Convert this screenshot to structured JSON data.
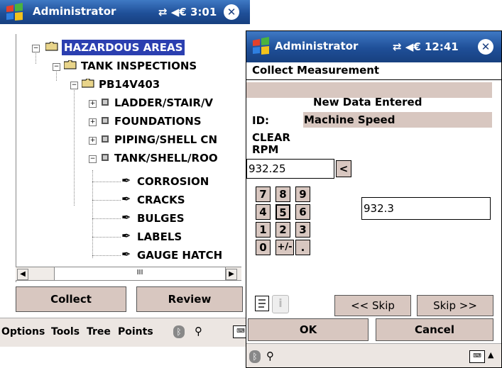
{
  "left_window": {
    "title": "Administrator",
    "status": "⇄ ◀€ 3:01",
    "tree": [
      {
        "label": "HAZARDOUS AREAS",
        "level": 1,
        "type": "folder",
        "expanded": true,
        "selected": true
      },
      {
        "label": "TANK INSPECTIONS",
        "level": 2,
        "type": "folder",
        "expanded": true
      },
      {
        "label": "PB14V403",
        "level": 3,
        "type": "folder",
        "expanded": true
      },
      {
        "label": "LADDER/STAIR/V",
        "level": 4,
        "type": "node",
        "expanded": false
      },
      {
        "label": "FOUNDATIONS",
        "level": 4,
        "type": "node",
        "expanded": false
      },
      {
        "label": "PIPING/SHELL CN",
        "level": 4,
        "type": "node",
        "expanded": false
      },
      {
        "label": "TANK/SHELL/ROO",
        "level": 4,
        "type": "node",
        "expanded": true
      },
      {
        "label": "CORROSION",
        "level": 5,
        "type": "point"
      },
      {
        "label": "CRACKS",
        "level": 5,
        "type": "point"
      },
      {
        "label": "BULGES",
        "level": 5,
        "type": "point"
      },
      {
        "label": "LABELS",
        "level": 5,
        "type": "point"
      },
      {
        "label": "GAUGE HATCH",
        "level": 5,
        "type": "point"
      }
    ],
    "scroll_thumb": "III",
    "buttons": {
      "collect": "Collect",
      "review": "Review"
    },
    "menu": {
      "options": "Options",
      "tools": "Tools",
      "tree": "Tree",
      "points": "Points"
    }
  },
  "right_window": {
    "title": "Administrator",
    "status": "⇄ ◀€ 12:41",
    "heading": "Collect Measurement",
    "status_line": "New Data Entered",
    "id_label": "ID:",
    "id_value": "Machine Speed",
    "clear_label": "CLEAR",
    "units_label": "RPM",
    "input_value": "932.25",
    "backspace": "<",
    "keypad": [
      [
        "7",
        "8",
        "9"
      ],
      [
        "4",
        "5",
        "6"
      ],
      [
        "1",
        "2",
        "3"
      ],
      [
        "0",
        "+/-",
        "."
      ]
    ],
    "display_value": "932.3",
    "skip_back": "<< Skip",
    "skip_forward": "Skip >>",
    "ok": "OK",
    "cancel": "Cancel"
  },
  "colors": {
    "title_blue": "#1f4f98",
    "button_tan": "#d8c7c0",
    "field_tan": "#d8c7c0",
    "selection": "#2b3fb0"
  }
}
